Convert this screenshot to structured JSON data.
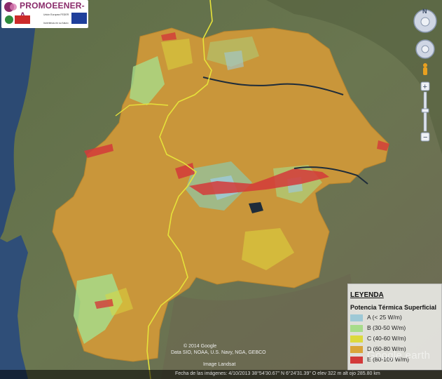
{
  "logo": {
    "title": "PROMOEENER-A",
    "sub1": "Unión Europea FEDER",
    "sub2": "Invertimos en su futuro"
  },
  "legend": {
    "title": "LEYENDA",
    "subtitle": "Potencia Térmica Superficial",
    "items": [
      {
        "label": "A (< 25 W/m)",
        "color": "#9ec9d6"
      },
      {
        "label": "B (30-50 W/m)",
        "color": "#a7dc8a"
      },
      {
        "label": "C (40-60 W/m)",
        "color": "#dcd93e"
      },
      {
        "label": "D (60-80 W/m)",
        "color": "#d9a53a"
      },
      {
        "label": "E (80-100 W/m)",
        "color": "#d33a3a"
      }
    ]
  },
  "attribution": {
    "copyright": "© 2014 Google",
    "sources": "Data SIO, NOAA, U.S. Navy, NGA, GEBCO",
    "geo": "Image Landsat"
  },
  "status_bar": {
    "text": "Fecha de las imágenes: 4/10/2013   38°54'30.67\" N   6°24'31.39\" O   elev 322 m   alt ojo 285.80 km"
  },
  "brand": "Google earth",
  "colors": {
    "sea": "#2c4a73",
    "terrain": "#5d6b45",
    "region": "#c9963a",
    "border": "#e6e23a"
  }
}
